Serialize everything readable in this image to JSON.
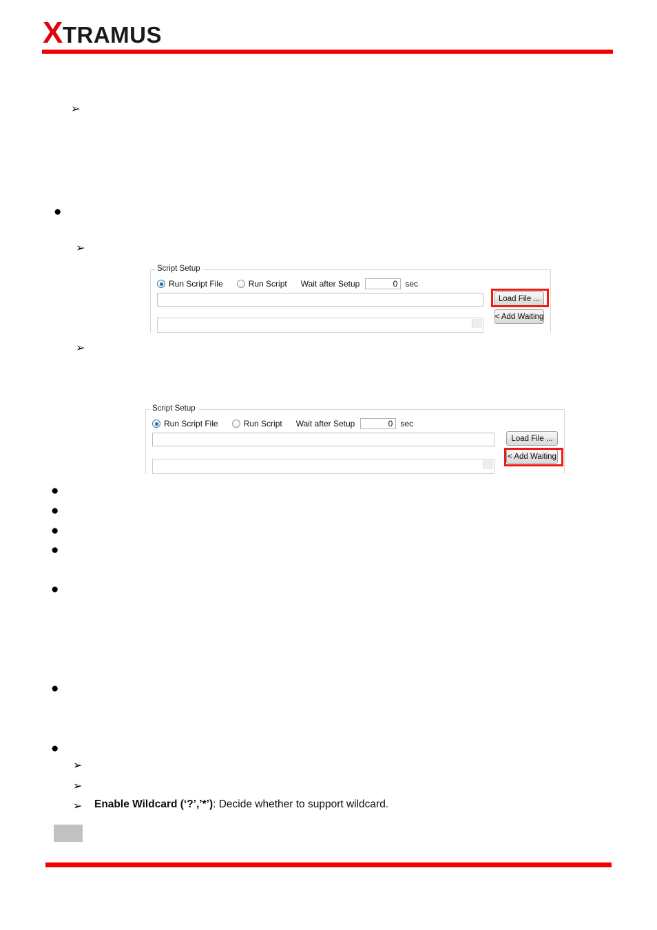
{
  "header": {
    "logo_x": "X",
    "logo_rest": "TRAMUS",
    "accent_color": "#f40000"
  },
  "footer": {
    "page_number": ""
  },
  "figures": [
    {
      "id": "figure-load-file",
      "group_title": "Script Setup",
      "radio_run_script_file": "Run Script File",
      "radio_run_script": "Run Script",
      "wait_label": "Wait after Setup",
      "wait_value": "0",
      "wait_unit": "sec",
      "script_path_value": "",
      "load_file_button": "Load File ...",
      "add_waiting_button": "< Add Waiting",
      "highlighted": "Load File ...",
      "highlight_color": "#ee1b14"
    },
    {
      "id": "figure-add-waiting",
      "group_title": "Script Setup",
      "radio_run_script_file": "Run Script File",
      "radio_run_script": "Run Script",
      "wait_label": "Wait after Setup",
      "wait_value": "0",
      "wait_unit": "sec",
      "script_path_value": "",
      "load_file_button": "Load File ...",
      "add_waiting_button": "< Add Waiting",
      "highlighted": "< Add Waiting",
      "highlight_color": "#ee1b14"
    }
  ],
  "content": {
    "wildcard_item_bold": "Enable Wildcard (‘?’,’*’)",
    "wildcard_item_rest": ": Decide whether to support wildcard.",
    "arrow_marker": "➢",
    "dot_marker": "●"
  }
}
